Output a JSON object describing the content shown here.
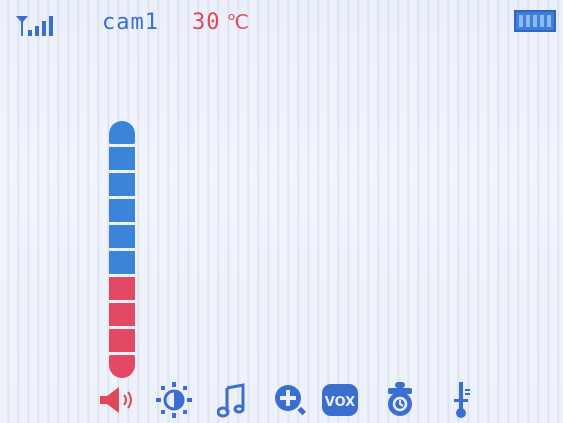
{
  "status_bar": {
    "signal_icon": "signal-strength-icon",
    "camera_name": "cam1",
    "temperature_value": "30",
    "temperature_unit": "℃",
    "battery_icon": "battery-full-icon"
  },
  "volume_meter": {
    "level": 1.0,
    "segments_total": 10,
    "segments_blue": 6,
    "segments_red": 4
  },
  "toolbar": {
    "items": [
      {
        "icon": "speaker-volume-icon",
        "selected": true
      },
      {
        "icon": "brightness-icon",
        "selected": false
      },
      {
        "icon": "music-note-icon",
        "selected": false
      },
      {
        "icon": "zoom-in-icon",
        "selected": false
      },
      {
        "icon": "vox-icon",
        "label": "VOX",
        "selected": false
      },
      {
        "icon": "feeding-bottle-icon",
        "selected": false
      },
      {
        "icon": "thermometer-icon",
        "selected": false
      }
    ]
  },
  "colors": {
    "accent_blue": "#3a6fd0",
    "alert_red": "#e0485a",
    "meter_blue": "#3c84da",
    "meter_red": "#e24a63"
  }
}
